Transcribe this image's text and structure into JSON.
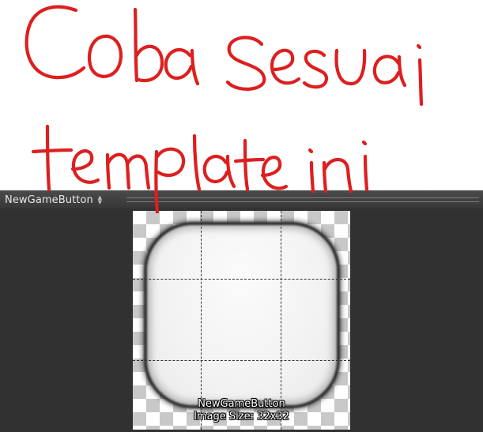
{
  "annotation": {
    "line1": "Coba Sesuai",
    "line2": "template ini",
    "ink_color": "#dd1f1f"
  },
  "panel": {
    "asset_name": "NewGameButton",
    "dropdown_icon": "up-down-arrows-icon"
  },
  "preview": {
    "caption_name": "NewGameButton",
    "caption_size": "Image Size: 32x32",
    "checker_color": "#c8c8c8",
    "background_color": "#313131"
  }
}
